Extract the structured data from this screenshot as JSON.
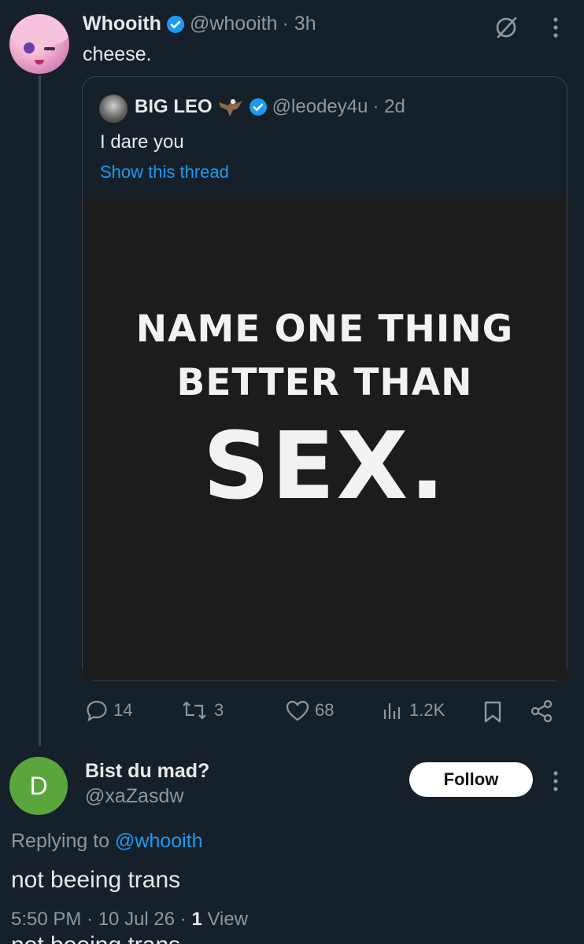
{
  "main_tweet": {
    "display_name": "Whooith",
    "handle": "@whooith",
    "time": "· 3h",
    "text": "cheese."
  },
  "quoted_tweet": {
    "display_name": "BIG LEO",
    "handle": "@leodey4u",
    "time": "· 2d",
    "text": "I dare you",
    "show_thread": "Show this thread",
    "image_text": {
      "line1": "NAME ONE THING",
      "line2": "BETTER THAN",
      "line3": "SEX."
    }
  },
  "actions": {
    "replies": "14",
    "retweets": "3",
    "likes": "68",
    "views": "1.2K"
  },
  "reply": {
    "avatar_letter": "D",
    "display_name": "Bist du mad?",
    "handle": "@xaZasdw",
    "follow_label": "Follow",
    "replying_to_prefix": "Replying to ",
    "replying_to_handle": "@whooith",
    "text": "not beeing trans",
    "timestamp": "5:50 PM · 10 Jul 26 · ",
    "view_count": "1",
    "view_label": " View",
    "cut_off_text": "not beeing trans"
  },
  "colors": {
    "background": "#15202b",
    "accent": "#1d9bf0",
    "muted": "#8b98a5",
    "avatar_green": "#5aa53c"
  }
}
